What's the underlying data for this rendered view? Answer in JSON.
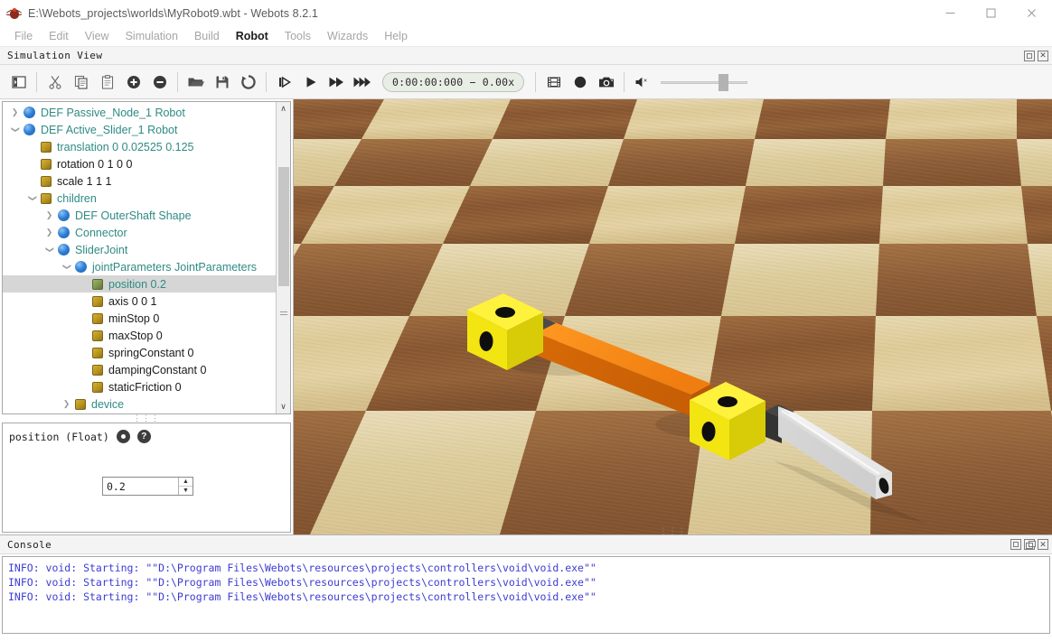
{
  "window": {
    "title": "E:\\Webots_projects\\worlds\\MyRobot9.wbt - Webots 8.2.1",
    "minimize_label": "—",
    "maximize_label": "□",
    "close_label": "✕"
  },
  "menubar": {
    "items": [
      {
        "label": "File",
        "active": false
      },
      {
        "label": "Edit",
        "active": false
      },
      {
        "label": "View",
        "active": false
      },
      {
        "label": "Simulation",
        "active": false
      },
      {
        "label": "Build",
        "active": false
      },
      {
        "label": "Robot",
        "active": true
      },
      {
        "label": "Tools",
        "active": false
      },
      {
        "label": "Wizards",
        "active": false
      },
      {
        "label": "Help",
        "active": false
      }
    ]
  },
  "simulation_view": {
    "panel_title": "Simulation View",
    "toolbar": {
      "sidebar_toggle": "sidebar-toggle-icon",
      "cut": "cut-icon",
      "copy": "copy-icon",
      "paste": "paste-icon",
      "add": "add-node-icon",
      "remove": "remove-node-icon",
      "open": "open-world-icon",
      "save": "save-world-icon",
      "reload": "reload-world-icon",
      "step": "step-icon",
      "play": "play-icon",
      "fast_forward": "fast-forward-icon",
      "run": "run-icon",
      "movie": "movie-icon",
      "record": "record-icon",
      "screenshot": "screenshot-icon",
      "sound": "sound-mute-icon"
    },
    "time_display": "0:00:00:000  −  0.00x",
    "volume_percent": 75,
    "panel_buttons": {
      "float": "float-icon",
      "close": "close-icon"
    }
  },
  "scene_tree": {
    "rows": [
      {
        "indent": 0,
        "expander": "right",
        "icon": "node",
        "label": "DEF Passive_Node_1 Robot",
        "color": "teal",
        "selected": false
      },
      {
        "indent": 0,
        "expander": "down",
        "icon": "node",
        "label": "DEF Active_Slider_1 Robot",
        "color": "teal",
        "selected": false
      },
      {
        "indent": 1,
        "expander": "none",
        "icon": "field",
        "label": "translation 0 0.02525 0.125",
        "color": "teal",
        "selected": false
      },
      {
        "indent": 1,
        "expander": "none",
        "icon": "field",
        "label": "rotation 0 1 0 0",
        "color": "black",
        "selected": false
      },
      {
        "indent": 1,
        "expander": "none",
        "icon": "field",
        "label": "scale 1 1 1",
        "color": "black",
        "selected": false
      },
      {
        "indent": 1,
        "expander": "down",
        "icon": "field",
        "label": "children",
        "color": "teal",
        "selected": false
      },
      {
        "indent": 2,
        "expander": "right",
        "icon": "node",
        "label": "DEF OuterShaft Shape",
        "color": "teal",
        "selected": false
      },
      {
        "indent": 2,
        "expander": "right",
        "icon": "node",
        "label": "Connector",
        "color": "teal",
        "selected": false
      },
      {
        "indent": 2,
        "expander": "down",
        "icon": "node",
        "label": "SliderJoint",
        "color": "teal",
        "selected": false
      },
      {
        "indent": 3,
        "expander": "down",
        "icon": "node",
        "label": "jointParameters JointParameters",
        "color": "teal",
        "selected": false
      },
      {
        "indent": 4,
        "expander": "none",
        "icon": "field-green",
        "label": "position 0.2",
        "color": "teal",
        "selected": true
      },
      {
        "indent": 4,
        "expander": "none",
        "icon": "field",
        "label": "axis 0 0 1",
        "color": "black",
        "selected": false
      },
      {
        "indent": 4,
        "expander": "none",
        "icon": "field",
        "label": "minStop 0",
        "color": "black",
        "selected": false
      },
      {
        "indent": 4,
        "expander": "none",
        "icon": "field",
        "label": "maxStop 0",
        "color": "black",
        "selected": false
      },
      {
        "indent": 4,
        "expander": "none",
        "icon": "field",
        "label": "springConstant 0",
        "color": "black",
        "selected": false
      },
      {
        "indent": 4,
        "expander": "none",
        "icon": "field",
        "label": "dampingConstant 0",
        "color": "black",
        "selected": false
      },
      {
        "indent": 4,
        "expander": "none",
        "icon": "field",
        "label": "staticFriction 0",
        "color": "black",
        "selected": false
      },
      {
        "indent": 3,
        "expander": "right",
        "icon": "field",
        "label": "device",
        "color": "teal",
        "selected": false
      }
    ],
    "scroll_up": "∧",
    "scroll_down": "∨"
  },
  "field_editor": {
    "label": "position (Float)",
    "reset_icon": "reset-icon",
    "help_icon": "help-icon",
    "help_glyph": "?",
    "value": "0.2",
    "spin_up": "▲",
    "spin_down": "▼"
  },
  "console": {
    "panel_title": "Console",
    "panel_buttons": {
      "maximize": "maximize-icon",
      "float": "float-icon",
      "close": "close-icon"
    },
    "lines": [
      "INFO: void: Starting: \"\"D:\\Program Files\\Webots\\resources\\projects\\controllers\\void\\void.exe\"\"",
      "INFO: void: Starting: \"\"D:\\Program Files\\Webots\\resources\\projects\\controllers\\void\\void.exe\"\"",
      "INFO: void: Starting: \"\"D:\\Program Files\\Webots\\resources\\projects\\controllers\\void\\void.exe\"\""
    ]
  },
  "viewport": {
    "name": "3d-simulation-viewport",
    "floor_light_color": "#ddc896",
    "floor_dark_color": "#8d5a30",
    "robot_cube_color": "#f2e811",
    "robot_shaft_orange": "#f07d10",
    "robot_shaft_white": "#e8e8e8",
    "hole_color": "#111111"
  }
}
